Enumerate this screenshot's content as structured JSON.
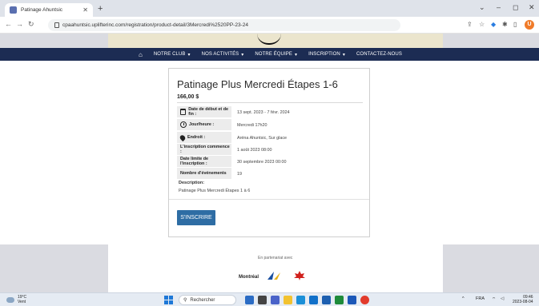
{
  "browser": {
    "tab_title": "Patinage Ahuntsic",
    "new_tab": "+",
    "url": "cpaahuntsic.uplifterinc.com/registration/product-detail/3Mercredi%2520PP-23-24",
    "profile_initial": "U"
  },
  "nav": {
    "items": [
      {
        "label": "NOTRE CLUB",
        "caret": true
      },
      {
        "label": "NOS ACTIVITÉS",
        "caret": true
      },
      {
        "label": "NOTRE ÉQUIPE",
        "caret": true
      },
      {
        "label": "INSCRIPTION",
        "caret": true
      },
      {
        "label": "CONTACTEZ-NOUS",
        "caret": false
      }
    ]
  },
  "product": {
    "title": "Patinage Plus Mercredi Étapes 1-6",
    "price": "166,00 $",
    "details": [
      {
        "label": "Date de début et de fin :",
        "value": "13 sept. 2023 - 7 févr. 2024",
        "icon": "calendar-icon"
      },
      {
        "label": "Jour/heure :",
        "value": "Mercredi 17h20",
        "icon": "clock-icon"
      },
      {
        "label": "Endroit :",
        "value": "Aréna Ahuntsic, Sur glace",
        "icon": "map-pin-icon"
      },
      {
        "label": "L'inscription commence :",
        "value": "1 août 2023 08:00",
        "icon": ""
      },
      {
        "label": "Date limite de l'inscription :",
        "value": "30 septembre 2023 00:00",
        "icon": ""
      },
      {
        "label": "Nombre d'événements",
        "value": "19",
        "icon": ""
      }
    ],
    "description_label": "Description:",
    "description": "Patinage Plus Mercredi Étapes 1 à 6",
    "register_label": "S'INSCRIRE"
  },
  "footer": {
    "partner_text": "En partenariat avec",
    "montreal_logo_text": "Montréal"
  },
  "taskbar": {
    "temp": "19°C",
    "weather": "Vent",
    "search_placeholder": "Rechercher",
    "lang": "FRA",
    "time": "09:46",
    "date": "2023-08-04"
  }
}
